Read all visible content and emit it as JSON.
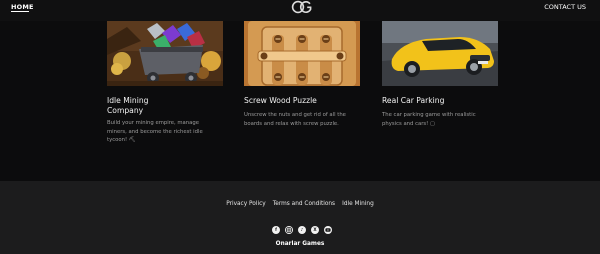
{
  "nav": {
    "home_label": "HOME",
    "contact_label": "CONTACT US",
    "logo_icon": "og-logo-icon"
  },
  "games": [
    {
      "title_line1": "Idle Mining",
      "title_line2": "Company",
      "description_lines": [
        "Build your mining empire, manage",
        "miners, and become the richest idle",
        "tycoon! ⛏"
      ]
    },
    {
      "title_line1": "Screw Wood Puzzle",
      "title_line2": "",
      "description_lines": [
        "Unscrew the nuts and get rid of all the",
        "boards and relax with screw puzzle."
      ]
    },
    {
      "title_line1": "Real Car Parking",
      "title_line2": "",
      "description_lines": [
        "The car parking game with realistic",
        "physics and cars! ▢"
      ]
    }
  ],
  "footer": {
    "links": [
      "Privacy Policy",
      "Terms and Conditions",
      "Idle Mining"
    ],
    "socials": [
      "facebook-icon",
      "instagram-icon",
      "tiktok-icon",
      "x-icon",
      "youtube-icon"
    ],
    "brand": "Onarlar Games"
  },
  "colors": {
    "background": "#0c0c0d",
    "footer": "#1c1c1d",
    "car": "#f2c21a",
    "wood": "#d49a52"
  }
}
